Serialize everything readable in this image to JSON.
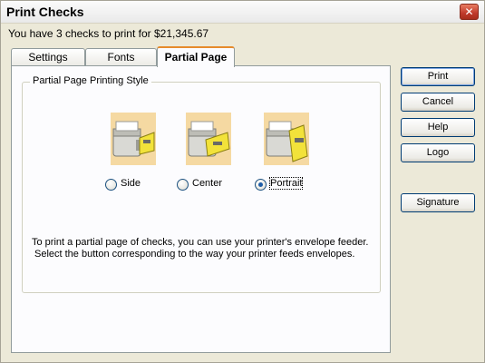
{
  "window": {
    "title": "Print Checks",
    "close_label": "✕"
  },
  "summary": "You have 3 checks to print for $21,345.67",
  "tabs": [
    {
      "label": "Settings",
      "active": false
    },
    {
      "label": "Fonts",
      "active": false
    },
    {
      "label": "Partial Page",
      "active": true
    }
  ],
  "group": {
    "title": "Partial Page Printing Style",
    "options": [
      {
        "label": "Side",
        "selected": false
      },
      {
        "label": "Center",
        "selected": false
      },
      {
        "label": "Portrait",
        "selected": true
      }
    ],
    "info_line1": "To print a partial page of checks,  you can use your printer's envelope feeder.",
    "info_line2": "Select the button corresponding to the way your printer feeds envelopes."
  },
  "buttons": {
    "print": "Print",
    "cancel": "Cancel",
    "help": "Help",
    "logo": "Logo",
    "signature": "Signature"
  },
  "colors": {
    "accent_tab": "#e68b2c",
    "paper_yellow": "#f2e23a",
    "button_border": "#003c74"
  }
}
